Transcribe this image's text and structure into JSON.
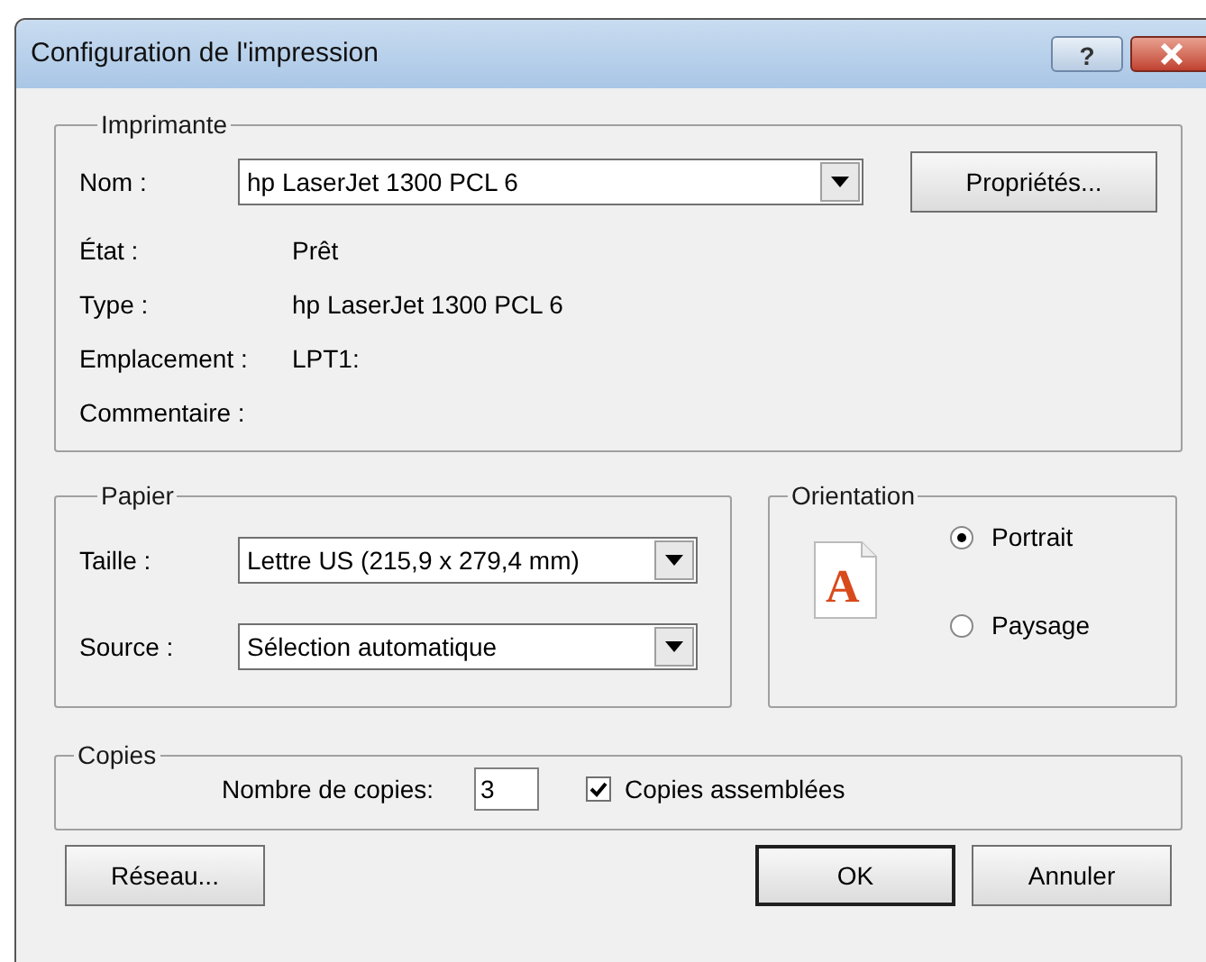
{
  "window": {
    "title": "Configuration de l'impression",
    "help_button": "?"
  },
  "printer": {
    "legend": "Imprimante",
    "name_label": "Nom :",
    "name_value": "hp LaserJet 1300 PCL 6",
    "properties_button": "Propriétés...",
    "info": [
      {
        "label": "État :",
        "value": "Prêt"
      },
      {
        "label": "Type :",
        "value": "hp LaserJet 1300 PCL 6"
      },
      {
        "label": "Emplacement :",
        "value": "LPT1:"
      },
      {
        "label": "Commentaire :"
      }
    ]
  },
  "paper": {
    "legend": "Papier",
    "fields": [
      {
        "label": "Taille :",
        "value": "Lettre US (215,9 x 279,4 mm)"
      },
      {
        "label": "Source :",
        "value": "Sélection automatique"
      }
    ]
  },
  "orientation": {
    "legend": "Orientation",
    "icon_letter": "A",
    "options": [
      {
        "label": "Portrait",
        "selected": true
      },
      {
        "label": "Paysage",
        "selected": false
      }
    ]
  },
  "copies": {
    "legend": "Copies",
    "count_label": "Nombre de copies:",
    "count": "3",
    "collate_label": "Copies assemblées",
    "collate_checked": true
  },
  "buttons": [
    {
      "label": "Réseau...",
      "default": false
    },
    {
      "label": "OK",
      "default": true
    },
    {
      "label": "Annuler",
      "default": false
    }
  ]
}
